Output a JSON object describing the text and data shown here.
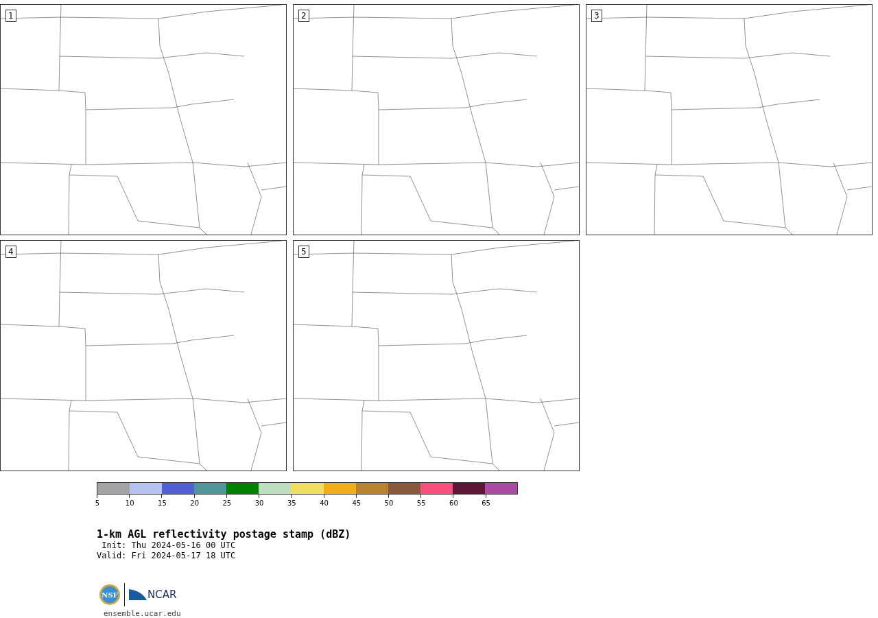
{
  "panels": [
    {
      "number": "1"
    },
    {
      "number": "2"
    },
    {
      "number": "3"
    },
    {
      "number": "4"
    },
    {
      "number": "5"
    }
  ],
  "colorbar": {
    "bins": [
      {
        "color": "#a3a3a3"
      },
      {
        "color": "#b7c3ef"
      },
      {
        "color": "#515fd6"
      },
      {
        "color": "#4f9599"
      },
      {
        "color": "#008200"
      },
      {
        "color": "#bddfbe"
      },
      {
        "color": "#f0dc5e"
      },
      {
        "color": "#f0ac19"
      },
      {
        "color": "#b8822f"
      },
      {
        "color": "#8a5a3e"
      },
      {
        "color": "#f64f7e"
      },
      {
        "color": "#5e1734"
      },
      {
        "color": "#ac4ba3"
      }
    ],
    "ticks": [
      "5",
      "10",
      "15",
      "20",
      "25",
      "30",
      "35",
      "40",
      "45",
      "50",
      "55",
      "60",
      "65"
    ]
  },
  "title": "1-km AGL reflectivity postage stamp (dBZ)",
  "init": " Init: Thu 2024-05-16 00 UTC",
  "valid": "Valid: Fri 2024-05-17 18 UTC",
  "logos": {
    "nsf": "NSF",
    "ncar": "NCAR"
  },
  "url": "ensemble.ucar.edu"
}
